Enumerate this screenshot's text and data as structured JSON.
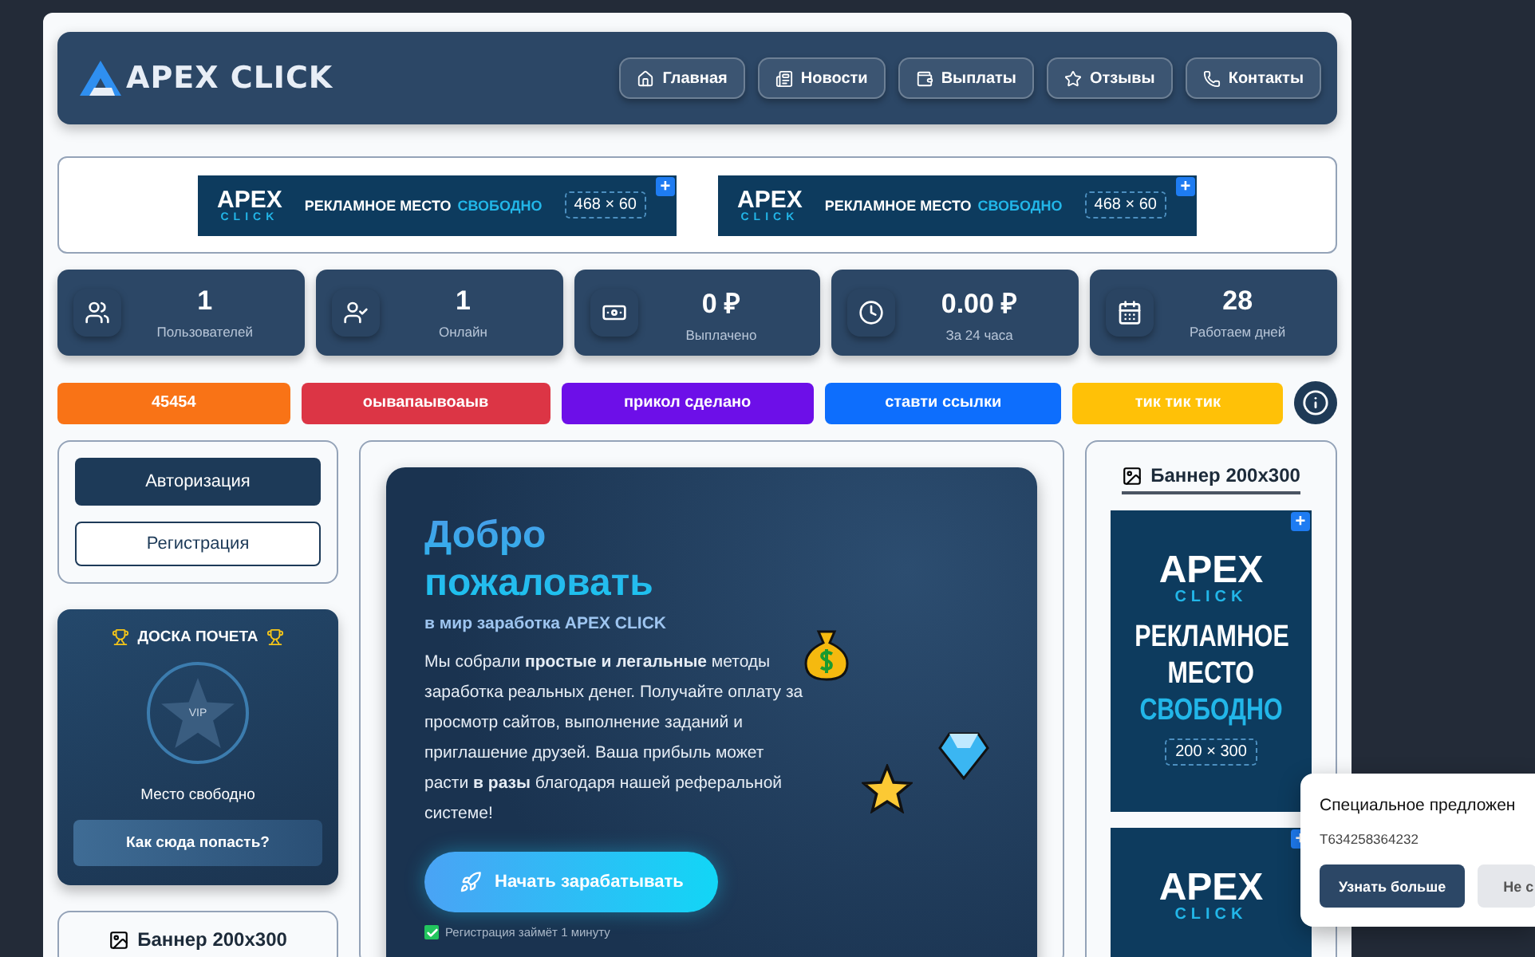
{
  "header": {
    "logo": "APEX CLICK",
    "nav": [
      {
        "label": "Главная",
        "kind": "home"
      },
      {
        "label": "Новости",
        "kind": "news"
      },
      {
        "label": "Выплаты",
        "kind": "payouts"
      },
      {
        "label": "Отзывы",
        "kind": "reviews"
      },
      {
        "label": "Контакты",
        "kind": "contacts"
      }
    ]
  },
  "top_ads": [
    {
      "brand": "APEX",
      "brand_sub": "CLICK",
      "text": "РЕКЛАМНОЕ МЕСТО",
      "highlight": "СВОБОДНО",
      "size": "468 × 60",
      "badge": "+"
    },
    {
      "brand": "APEX",
      "brand_sub": "CLICK",
      "text": "РЕКЛАМНОЕ МЕСТО",
      "highlight": "СВОБОДНО",
      "size": "468 × 60",
      "badge": "+"
    }
  ],
  "stats": [
    {
      "value": "1",
      "label": "Пользователей",
      "kind": "users"
    },
    {
      "value": "1",
      "label": "Онлайн",
      "kind": "online"
    },
    {
      "value": "0 ₽",
      "label": "Выплачено",
      "kind": "paid"
    },
    {
      "value": "0.00 ₽",
      "label": "За 24 часа",
      "kind": "day"
    },
    {
      "value": "28",
      "label": "Работаем дней",
      "kind": "calendar"
    }
  ],
  "tags": [
    {
      "label": "45454",
      "color": "#f97316"
    },
    {
      "label": "оывапаывоаыв",
      "color": "#dc3545"
    },
    {
      "label": "прикол сделано",
      "color": "#6d0fe8"
    },
    {
      "label": "ставти ссылки",
      "color": "#0d6efd"
    },
    {
      "label": "тик тик тик",
      "color": "#ffc107"
    }
  ],
  "auth": {
    "buttons": [
      {
        "label": "Авторизация",
        "kind": "primary"
      },
      {
        "label": "Регистрация",
        "kind": "outline"
      }
    ]
  },
  "honor_board": {
    "title": "ДОСКА ПОЧЕТА",
    "badge": "VIP",
    "status": "Место свободно",
    "button": "Как сюда попасть?"
  },
  "left_banner": {
    "title": "Баннер 200x300"
  },
  "hero": {
    "title": "Добро пожаловать",
    "subtitle": "в мир заработка APEX CLICK",
    "text": "Мы собрали **простые и легальные** методы заработка реальных денег. Получайте оплату за просмотр сайтов, выполнение заданий и приглашение друзей. Ваша прибыль может расти **в разы** благодаря нашей реферальной системе!",
    "button": "Начать зарабатывать",
    "note": "Регистрация займёт 1 минуту"
  },
  "right_banner": {
    "title": "Баннер 200x300",
    "ads": [
      {
        "brand": "APEX",
        "brand_sub": "CLICK",
        "lines": [
          "РЕКЛАМНОЕ",
          "МЕСТО"
        ],
        "highlight": "СВОБОДНО",
        "size": "200 × 300",
        "badge": "+"
      },
      {
        "brand": "APEX",
        "brand_sub": "CLICK",
        "badge": "+"
      }
    ]
  },
  "popup": {
    "title": "Специальное предложен",
    "code": "T634258364232",
    "buttons": [
      {
        "label": "Узнать больше",
        "kind": "primary"
      },
      {
        "label": "Не с",
        "kind": "secondary"
      }
    ]
  }
}
